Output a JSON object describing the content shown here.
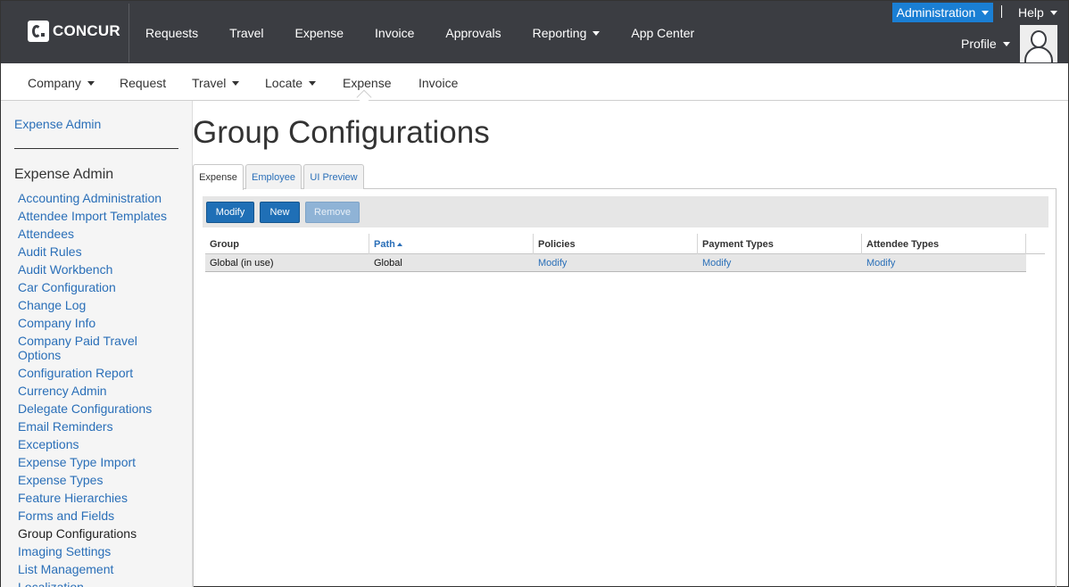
{
  "brand": {
    "name": "CONCUR"
  },
  "topnav": {
    "items": [
      "Requests",
      "Travel",
      "Expense",
      "Invoice",
      "Approvals",
      "Reporting",
      "App Center"
    ],
    "admin_label": "Administration",
    "help_label": "Help",
    "profile_label": "Profile"
  },
  "subnav": {
    "items": [
      "Company",
      "Request",
      "Travel",
      "Locate",
      "Expense",
      "Invoice"
    ],
    "active": "Expense"
  },
  "sidebar": {
    "top_link": "Expense Admin",
    "heading": "Expense Admin",
    "items": [
      "Accounting Administration",
      "Attendee Import Templates",
      "Attendees",
      "Audit Rules",
      "Audit Workbench",
      "Car Configuration",
      "Change Log",
      "Company Info",
      "Company Paid Travel Options",
      "Configuration Report",
      "Currency Admin",
      "Delegate Configurations",
      "Email Reminders",
      "Exceptions",
      "Expense Type Import",
      "Expense Types",
      "Feature Hierarchies",
      "Forms and Fields",
      "Group Configurations",
      "Imaging Settings",
      "List Management",
      "Localization"
    ],
    "active": "Group Configurations"
  },
  "page": {
    "title": "Group Configurations",
    "tabs": [
      "Expense",
      "Employee",
      "UI Preview"
    ],
    "active_tab": "Expense"
  },
  "toolbar": {
    "modify_label": "Modify",
    "new_label": "New",
    "remove_label": "Remove"
  },
  "table": {
    "columns": [
      "Group",
      "Path",
      "Policies",
      "Payment Types",
      "Attendee Types"
    ],
    "sorted_column": "Path",
    "rows": [
      {
        "group": "Global (in use)",
        "path": "Global",
        "policies": "Modify",
        "payment_types": "Modify",
        "attendee_types": "Modify"
      }
    ]
  },
  "colors": {
    "topbar": "#3b3d42",
    "accent": "#1a7fd4",
    "link": "#2a6fb8",
    "button_primary": "#1f6fb6"
  }
}
